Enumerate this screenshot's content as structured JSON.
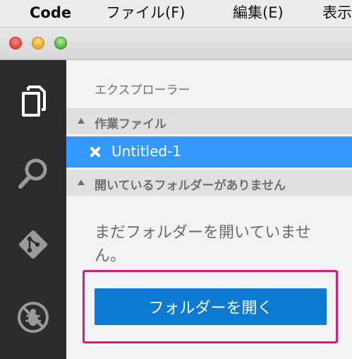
{
  "menubar": {
    "app": "Code",
    "file": "ファイル(F)",
    "edit": "編集(E)",
    "view": "表示"
  },
  "activity_icons": [
    "explorer-icon",
    "search-icon",
    "git-icon",
    "debug-icon"
  ],
  "explorer": {
    "title": "エクスプローラー",
    "working_files_header": "作業ファイル",
    "working_files": [
      {
        "name": "Untitled-1",
        "selected": true
      }
    ],
    "no_folder_header": "開いているフォルダーがありません",
    "empty_message": "まだフォルダーを開いていません。",
    "open_folder_label": "フォルダーを開く"
  },
  "colors": {
    "selection": "#3399ff",
    "button": "#0e7ad1",
    "highlight_border": "#d81b74",
    "activity_bar": "#2c2c2c"
  }
}
